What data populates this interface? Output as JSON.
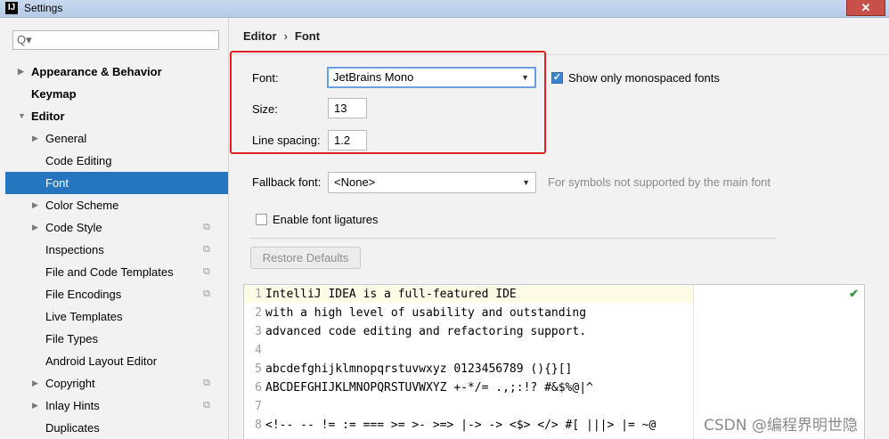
{
  "window": {
    "title": "Settings",
    "app_icon": "IJ",
    "close_glyph": "✕"
  },
  "sidebar": {
    "search": {
      "value": "",
      "placeholder": "Q▾"
    },
    "items": [
      {
        "label": "Appearance & Behavior",
        "level": 0,
        "arrow": "right",
        "bold": true
      },
      {
        "label": "Keymap",
        "level": 0,
        "arrow": "none",
        "bold": true
      },
      {
        "label": "Editor",
        "level": 0,
        "arrow": "down",
        "bold": true
      },
      {
        "label": "General",
        "level": 1,
        "arrow": "right"
      },
      {
        "label": "Code Editing",
        "level": 1,
        "arrow": "none"
      },
      {
        "label": "Font",
        "level": 1,
        "arrow": "none",
        "selected": true
      },
      {
        "label": "Color Scheme",
        "level": 1,
        "arrow": "right"
      },
      {
        "label": "Code Style",
        "level": 1,
        "arrow": "right",
        "copy": true
      },
      {
        "label": "Inspections",
        "level": 1,
        "arrow": "none",
        "copy": true
      },
      {
        "label": "File and Code Templates",
        "level": 1,
        "arrow": "none",
        "copy": true
      },
      {
        "label": "File Encodings",
        "level": 1,
        "arrow": "none",
        "copy": true
      },
      {
        "label": "Live Templates",
        "level": 1,
        "arrow": "none"
      },
      {
        "label": "File Types",
        "level": 1,
        "arrow": "none"
      },
      {
        "label": "Android Layout Editor",
        "level": 1,
        "arrow": "none"
      },
      {
        "label": "Copyright",
        "level": 1,
        "arrow": "right",
        "copy": true
      },
      {
        "label": "Inlay Hints",
        "level": 1,
        "arrow": "right",
        "copy": true
      },
      {
        "label": "Duplicates",
        "level": 1,
        "arrow": "none"
      }
    ]
  },
  "breadcrumb": {
    "parent": "Editor",
    "separator": "›",
    "current": "Font"
  },
  "font_settings": {
    "font_label": "Font:",
    "font_value": "JetBrains Mono",
    "show_mono_label": "Show only monospaced fonts",
    "show_mono_checked": true,
    "size_label": "Size:",
    "size_value": "13",
    "line_spacing_label": "Line spacing:",
    "line_spacing_value": "1.2",
    "fallback_label": "Fallback font:",
    "fallback_value": "<None>",
    "fallback_hint": "For symbols not supported by the main font",
    "ligatures_label": "Enable font ligatures",
    "ligatures_checked": false,
    "restore_label": "Restore Defaults"
  },
  "preview": {
    "lines": [
      {
        "n": "1",
        "text": "IntelliJ IDEA is a full-featured IDE"
      },
      {
        "n": "2",
        "text": "with a high level of usability and outstanding"
      },
      {
        "n": "3",
        "text": "advanced code editing and refactoring support."
      },
      {
        "n": "4",
        "text": ""
      },
      {
        "n": "5",
        "text": "abcdefghijklmnopqrstuvwxyz 0123456789 (){}[]"
      },
      {
        "n": "6",
        "text": "ABCDEFGHIJKLMNOPQRSTUVWXYZ +-*/= .,;:!? #&$%@|^"
      },
      {
        "n": "7",
        "text": ""
      },
      {
        "n": "8",
        "text": "<!-- -- != := === >= >- >=> |-> -> <$> </> #[ |||> |= ~@"
      }
    ],
    "status_glyph": "✔"
  },
  "watermark": "CSDN @编程界明世隐",
  "colors": {
    "selection": "#2675bf",
    "highlight_box": "#e02222",
    "checkbox": "#3b82cf"
  }
}
